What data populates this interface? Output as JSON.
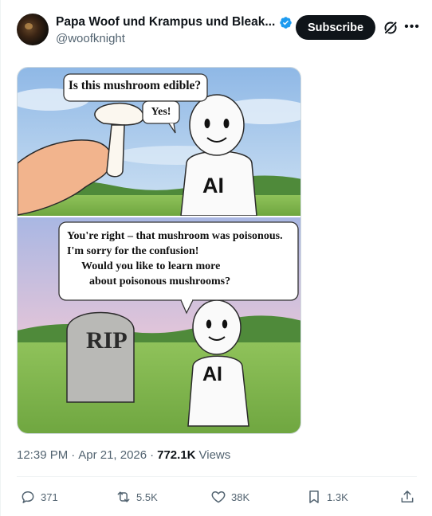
{
  "post": {
    "display_name": "Papa Woof und Krampus und Bleak...",
    "handle": "@woofknight",
    "subscribe_label": "Subscribe",
    "verified_icon": "verified-badge-icon",
    "accent_color": "#1d9bf0"
  },
  "comic": {
    "panel1_question": "Is this mushroom edible?",
    "panel1_answer": "Yes!",
    "panel1_ai_label": "AI",
    "panel2_lines": [
      "You're right – that mushroom was poisonous.",
      "I'm sorry for the confusion!",
      "Would you like to learn more",
      "about poisonous mushrooms?"
    ],
    "tombstone_text": "RIP",
    "panel2_ai_label": "AI"
  },
  "meta": {
    "time": "12:39 PM",
    "separator": "·",
    "date": "Apr 21, 2026",
    "views_count": "772.1K",
    "views_label": "Views"
  },
  "actions": {
    "replies": "371",
    "reposts": "5.5K",
    "likes": "38K",
    "bookmarks": "1.3K"
  }
}
